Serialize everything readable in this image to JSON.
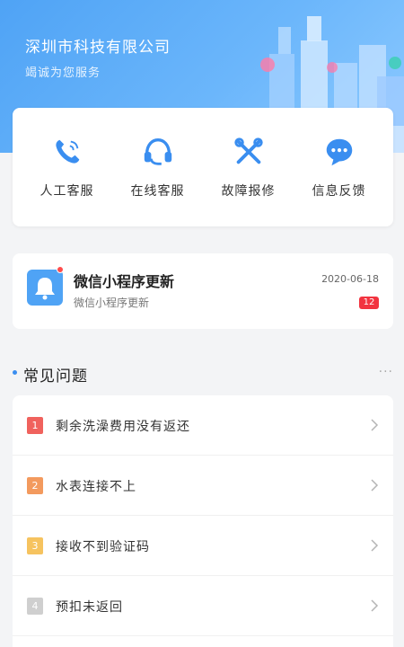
{
  "header": {
    "title": "深圳市科技有限公司",
    "subtitle": "竭诚为您服务"
  },
  "actions": [
    {
      "label": "人工客服",
      "icon": "phone-icon"
    },
    {
      "label": "在线客服",
      "icon": "headset-icon"
    },
    {
      "label": "故障报修",
      "icon": "tools-icon"
    },
    {
      "label": "信息反馈",
      "icon": "chat-icon"
    }
  ],
  "notice": {
    "title": "微信小程序更新",
    "subtitle": "微信小程序更新",
    "date": "2020-06-18",
    "badge": "12"
  },
  "faq": {
    "title": "常见问题",
    "more": "···",
    "items": [
      {
        "num": "1",
        "text": "剩余洗澡费用没有返还",
        "color": "#f0625d"
      },
      {
        "num": "2",
        "text": "水表连接不上",
        "color": "#f39a5e"
      },
      {
        "num": "3",
        "text": "接收不到验证码",
        "color": "#f6c35f"
      },
      {
        "num": "4",
        "text": "预扣未返回",
        "color": "#cfcfcf"
      }
    ]
  },
  "colors": {
    "accent": "#3a8ef0",
    "header": "#5aaaf7",
    "badge": "#f2333f"
  }
}
